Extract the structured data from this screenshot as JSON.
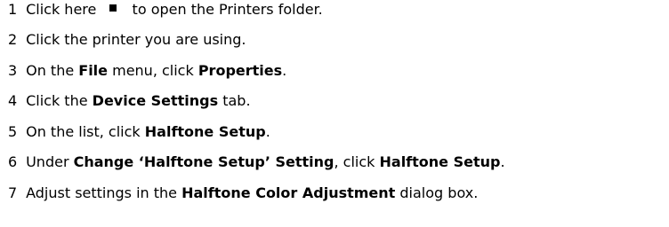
{
  "steps": [
    {
      "num": "1",
      "before": "Click here",
      "after": "to open the Printers folder."
    },
    {
      "num": "2",
      "text": "Click the printer you are using."
    },
    {
      "num": "3",
      "p1": "On the ",
      "b1": "File",
      "p2": " menu, click ",
      "b2": "Properties",
      "p3": "."
    },
    {
      "num": "4",
      "p1": "Click the ",
      "b1": "Device Settings",
      "p2": " tab."
    },
    {
      "num": "5",
      "p1": "On the list, click ",
      "b1": "Halftone Setup",
      "p2": "."
    },
    {
      "num": "6",
      "p1": "Under ",
      "b1": "Change ‘Halftone Setup’ Setting",
      "p2": ", click ",
      "b2": "Halftone Setup",
      "p3": "."
    },
    {
      "num": "7",
      "p1": "Adjust settings in the ",
      "b1": "Halftone Color Adjustment",
      "p2": " dialog box."
    }
  ],
  "icons": {
    "shortcut": "printers-folder-shortcut-icon"
  }
}
